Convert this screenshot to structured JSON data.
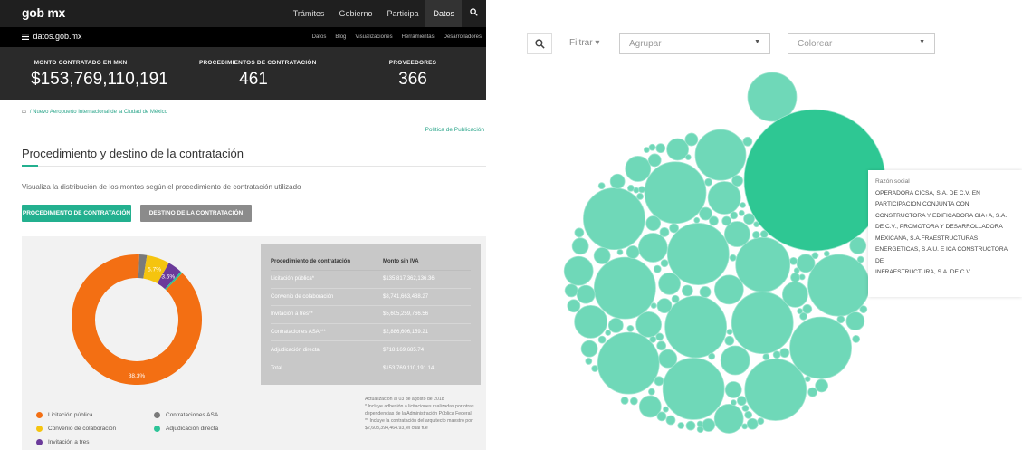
{
  "left": {
    "topbar": {
      "logo": "gob mx",
      "nav": [
        "Trámites",
        "Gobierno",
        "Participa",
        "Datos"
      ],
      "active": "Datos"
    },
    "subbar": {
      "brand": "datos.gob.mx",
      "links": [
        "Datos",
        "Blog",
        "Visualizaciones",
        "Herramientas",
        "Desarrolladores"
      ]
    },
    "stats": [
      {
        "label": "MONTO CONTRATADO EN MXN",
        "value": "$153,769,110,191"
      },
      {
        "label": "PROCEDIMIENTOS DE CONTRATACIÓN",
        "value": "461"
      },
      {
        "label": "PROVEEDORES",
        "value": "366"
      }
    ],
    "breadcrumb": "/ Nuevo Aeropuerto Internacional de la Ciudad de México",
    "politica": "Política de Publicación",
    "section_title": "Procedimiento y destino de la contratación",
    "section_desc": "Visualiza la distribución de los montos según el procedimiento de contratación utilizado",
    "buttons": {
      "procedimiento": "PROCEDIMIENTO DE CONTRATACIÓN",
      "destino": "DESTINO DE LA CONTRATACIÓN"
    },
    "table": {
      "headers": [
        "Procedimiento de contratación",
        "Monto sin IVA"
      ],
      "rows": [
        [
          "Licitación pública*",
          "$135,817,362,136.36"
        ],
        [
          "Convenio de colaboración",
          "$8,741,663,488.27"
        ],
        [
          "Invitación a tres**",
          "$5,605,259,766.56"
        ],
        [
          "Contrataciones ASA***",
          "$2,886,606,159.21"
        ],
        [
          "Adjudicación directa",
          "$718,169,685.74"
        ],
        [
          "Total",
          "$153,769,110,191.14"
        ]
      ]
    },
    "notes": [
      "Actualización al 03 de agosto de 2018",
      "* Incluye adhesión a licitaciones realizadas por otras dependencias de la Administración Pública Federal",
      "** Incluye la contratación del arquitecto maestro por $2,603,394,464.93, el cual fue"
    ],
    "legend": [
      {
        "label": "Licitación pública",
        "color": "#f36f13"
      },
      {
        "label": "Contrataciones ASA",
        "color": "#7a7a7a"
      },
      {
        "label": "Convenio de colaboración",
        "color": "#f5c40f"
      },
      {
        "label": "Adjudicación directa",
        "color": "#2ec498"
      },
      {
        "label": "Invitación a tres",
        "color": "#6b3a9a"
      }
    ]
  },
  "chart_data": {
    "type": "pie",
    "categories": [
      "Licitación pública",
      "Contrataciones ASA",
      "Convenio de colaboración",
      "Invitación a tres",
      "Adjudicación directa"
    ],
    "values": [
      88.3,
      1.9,
      5.7,
      3.6,
      0.5
    ],
    "slice_labels": [
      "88.3%",
      "",
      "5.7%",
      "3.6%",
      ""
    ],
    "colors": [
      "#f36f13",
      "#7a7a7a",
      "#f5c40f",
      "#6b3a9a",
      "#2ec498"
    ],
    "donut": true
  },
  "right": {
    "filtrar": "Filtrar ▾",
    "agrupar": "Agrupar",
    "colorear": "Colorear",
    "tooltip": {
      "label": "Razón social",
      "lines": [
        "OPERADORA CICSA, S.A. DE C.V. EN",
        "PARTICIPACION CONJUNTA CON",
        "CONSTRUCTORA Y EDIFICADORA GIA+A, S.A.",
        "DE C.V., PROMOTORA Y DESARROLLADORA",
        "MEXICANA, S.A.FRAESTRUCTURAS",
        "ENERGETICAS, S.A.U. E ICA CONSTRUCTORA DE",
        "INFRAESTRUCTURA, S.A. DE C.V."
      ]
    },
    "bubble_color": "#6fd8b8",
    "highlight_color": "#2ec793"
  }
}
